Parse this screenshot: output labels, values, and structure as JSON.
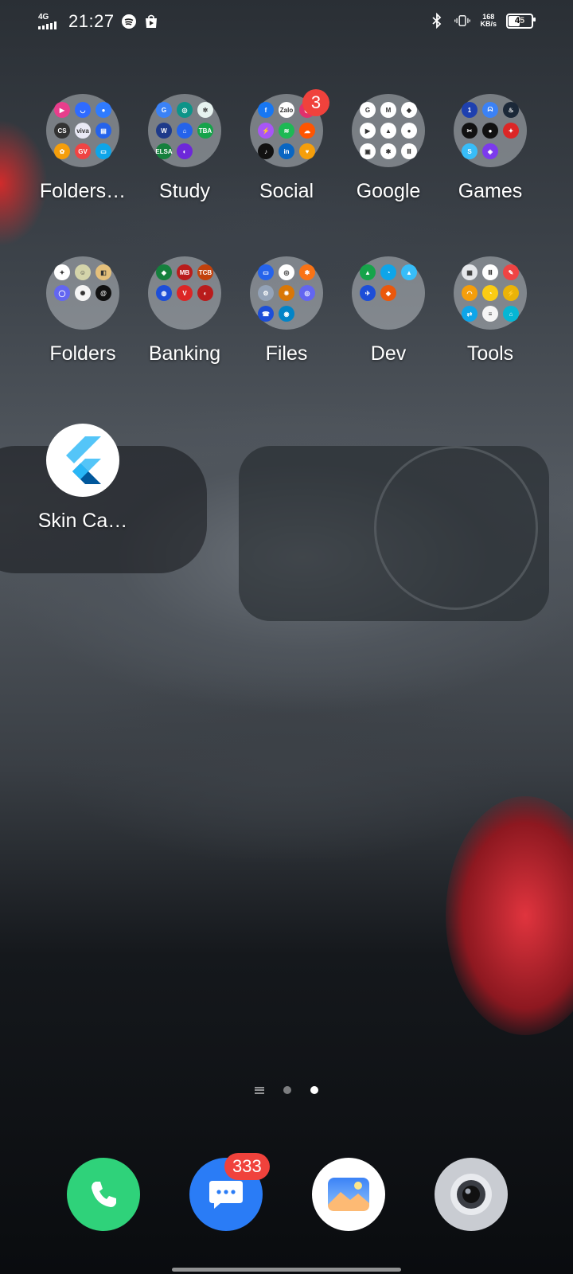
{
  "status_bar": {
    "network": "4G",
    "time": "21:27",
    "speed_value": "168",
    "speed_unit": "KB/s",
    "battery": "45",
    "icons": [
      "signal-icon",
      "spotify-icon",
      "store-icon",
      "bluetooth-icon",
      "vibrate-icon"
    ]
  },
  "folders_row1": [
    {
      "label": "Folders…",
      "icons": [
        [
          "#e83e8c",
          "▶"
        ],
        [
          "#2f6bff",
          "◡"
        ],
        [
          "#2f7bff",
          "●"
        ],
        [
          "#333",
          "CS"
        ],
        [
          "#e9e9f5",
          "viva"
        ],
        [
          "#2563eb",
          "▤"
        ],
        [
          "#f59e0b",
          "✿"
        ],
        [
          "#ef4444",
          "GV"
        ],
        [
          "#0ea5e9",
          "▭"
        ]
      ]
    },
    {
      "label": "Study",
      "icons": [
        [
          "#3b82f6",
          "G"
        ],
        [
          "#0d9488",
          "◎"
        ],
        [
          "#e6f2ef",
          "✲"
        ],
        [
          "#1e3a8a",
          "W"
        ],
        [
          "#2563eb",
          "⌂"
        ],
        [
          "#16a34a",
          "TBA"
        ],
        [
          "#15803d",
          "ELSA"
        ],
        [
          "#6d28d9",
          "◐"
        ]
      ]
    },
    {
      "label": "Social",
      "badge": "3",
      "icons": [
        [
          "#1877f2",
          "f"
        ],
        [
          "#ffffff",
          "Zalo"
        ],
        [
          "#e1306c",
          "◉"
        ],
        [
          "#a855f7",
          "⚡"
        ],
        [
          "#1db954",
          "≋"
        ],
        [
          "#ff5500",
          "☁"
        ],
        [
          "#111",
          "♪"
        ],
        [
          "#0a66c2",
          "in"
        ],
        [
          "#f59e0b",
          "♥"
        ]
      ]
    },
    {
      "label": "Google",
      "icons": [
        [
          "#ffffff",
          "G"
        ],
        [
          "#ffffff",
          "M"
        ],
        [
          "#ffffff",
          "◆"
        ],
        [
          "#ffffff",
          "▶"
        ],
        [
          "#ffffff",
          "▲"
        ],
        [
          "#ffffff",
          "●"
        ],
        [
          "#ffffff",
          "▣"
        ],
        [
          "#ffffff",
          "✱"
        ],
        [
          "#ffffff",
          "Ⅲ"
        ]
      ]
    },
    {
      "label": "Games",
      "icons": [
        [
          "#1e40af",
          "1"
        ],
        [
          "#3b82f6",
          "ᗣ"
        ],
        [
          "#1b2838",
          "♨"
        ],
        [
          "#111",
          "✂"
        ],
        [
          "#111",
          "●"
        ],
        [
          "#dc2626",
          "✦"
        ],
        [
          "#38bdf8",
          "S"
        ],
        [
          "#7c3aed",
          "◈"
        ]
      ]
    }
  ],
  "folders_row2": [
    {
      "label": "Folders",
      "icons": [
        [
          "#ffffff",
          "✦"
        ],
        [
          "#d4d4aa",
          "☺"
        ],
        [
          "#e5c07b",
          "◧"
        ],
        [
          "#6366f1",
          "◯"
        ],
        [
          "#f5f5f5",
          "✺"
        ],
        [
          "#111",
          "@"
        ]
      ]
    },
    {
      "label": "Banking",
      "icons": [
        [
          "#15803d",
          "◆"
        ],
        [
          "#b91c1c",
          "MB"
        ],
        [
          "#c2410c",
          "TCB"
        ],
        [
          "#1d4ed8",
          "◍"
        ],
        [
          "#dc2626",
          "V"
        ],
        [
          "#b91c1c",
          "◐"
        ]
      ]
    },
    {
      "label": "Files",
      "icons": [
        [
          "#2563eb",
          "▭"
        ],
        [
          "#ffffff",
          "◎"
        ],
        [
          "#f97316",
          "✱"
        ],
        [
          "#94a3b8",
          "⚙"
        ],
        [
          "#d97706",
          "✹"
        ],
        [
          "#6366f1",
          "◎"
        ],
        [
          "#1d4ed8",
          "☎"
        ],
        [
          "#0284c7",
          "◉"
        ]
      ]
    },
    {
      "label": "Dev",
      "icons": [
        [
          "#16a34a",
          "▲"
        ],
        [
          "#0ea5e9",
          "◔"
        ],
        [
          "#38bdf8",
          "▲"
        ],
        [
          "#1d4ed8",
          "✈"
        ],
        [
          "#ea580c",
          "◆"
        ]
      ]
    },
    {
      "label": "Tools",
      "icons": [
        [
          "#e5e7eb",
          "▦"
        ],
        [
          "#ffffff",
          "Ⅲ"
        ],
        [
          "#ef4444",
          "✎"
        ],
        [
          "#f59e0b",
          "◠"
        ],
        [
          "#facc15",
          "◔"
        ],
        [
          "#eab308",
          "⚡"
        ],
        [
          "#0ea5e9",
          "⇄"
        ],
        [
          "#f5f5f5",
          "≡"
        ],
        [
          "#06b6d4",
          "⌂"
        ]
      ]
    }
  ],
  "apps": [
    {
      "label": "Skin Ca…"
    }
  ],
  "dock": {
    "phone": "phone-icon",
    "messages_badge": "333",
    "gallery": "gallery-icon",
    "camera": "camera-icon"
  },
  "colors": {
    "badge": "#f0423c",
    "phone": "#2fd27a",
    "messages": "#2a7cf6"
  }
}
